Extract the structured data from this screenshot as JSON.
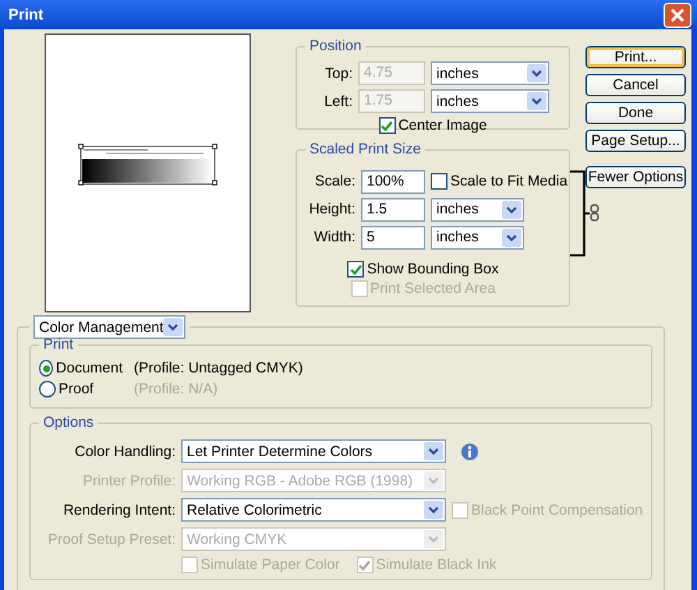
{
  "window": {
    "title": "Print"
  },
  "position": {
    "title": "Position",
    "fields": [
      {
        "label": "Top:",
        "value": "4.75",
        "unit": "inches",
        "disabled": true
      },
      {
        "label": "Left:",
        "value": "1.75",
        "unit": "inches",
        "disabled": true
      }
    ],
    "center_image": {
      "label": "Center Image",
      "checked": true
    }
  },
  "scaled_print_size": {
    "title": "Scaled Print Size",
    "scale": {
      "label": "Scale:",
      "value": "100%"
    },
    "scale_to_fit": {
      "label": "Scale to Fit Media",
      "checked": false
    },
    "fields": [
      {
        "label": "Height:",
        "value": "1.5",
        "unit": "inches",
        "disabled": false
      },
      {
        "label": "Width:",
        "value": "5",
        "unit": "inches",
        "disabled": false
      }
    ],
    "checkboxes": [
      {
        "label": "Show Bounding Box",
        "checked": true,
        "disabled": false
      },
      {
        "label": "Print Selected Area",
        "checked": false,
        "disabled": true
      }
    ]
  },
  "buttons": [
    {
      "label": "Print...",
      "hovered": true
    },
    {
      "label": "Cancel",
      "hovered": false
    },
    {
      "label": "Done",
      "hovered": false
    },
    {
      "label": "Page Setup...",
      "hovered": false
    },
    {
      "label": "Fewer Options",
      "hovered": false
    }
  ],
  "section_dropdown": {
    "value": "Color Management"
  },
  "print_group": {
    "title": "Print",
    "options": [
      {
        "label": "Document",
        "profile": "(Profile: Untagged CMYK)",
        "selected": true,
        "profile_disabled": false
      },
      {
        "label": "Proof",
        "profile": "(Profile: N/A)",
        "selected": false,
        "profile_disabled": true
      }
    ]
  },
  "options_group": {
    "title": "Options",
    "rows": [
      {
        "kind": "info",
        "label": "Color Handling:",
        "value": "Let Printer Determine Colors",
        "disabled": false
      },
      {
        "kind": "plain",
        "label": "Printer Profile:",
        "value": "Working RGB - Adobe RGB (1998)",
        "disabled": true
      },
      {
        "kind": "checkbox",
        "label": "Rendering Intent:",
        "value": "Relative Colorimetric",
        "disabled": false,
        "checkbox": {
          "label": "Black Point Compensation",
          "checked": false,
          "disabled": true
        }
      },
      {
        "kind": "plain",
        "label": "Proof Setup Preset:",
        "value": "Working CMYK",
        "disabled": true
      }
    ],
    "checkboxes": [
      {
        "label": "Simulate Paper Color",
        "checked": false,
        "disabled": true
      },
      {
        "label": "Simulate Black Ink",
        "checked": true,
        "disabled": true
      }
    ]
  }
}
